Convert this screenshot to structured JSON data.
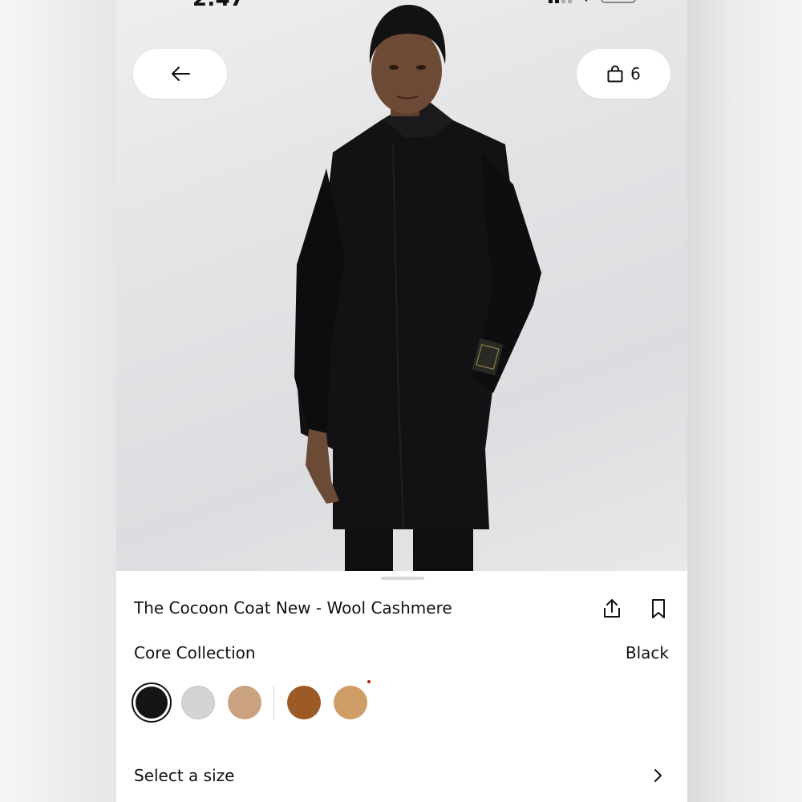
{
  "status_bar": {
    "time": "2:47"
  },
  "header": {
    "back_icon": "arrow-left-icon",
    "bag_icon": "shopping-bag-icon",
    "bag_count": "6"
  },
  "product": {
    "title": "The Cocoon Coat New - Wool Cashmere",
    "collection": "Core Collection",
    "selected_color": "Black",
    "actions": {
      "share_icon": "share-icon",
      "bookmark_icon": "bookmark-icon"
    },
    "swatches": [
      {
        "color": "#151515",
        "selected": true
      },
      {
        "color": "#d4d4d4",
        "selected": false
      },
      {
        "color": "#caa27f",
        "selected": false
      },
      {
        "color": "#9c5a27",
        "selected": false
      },
      {
        "color": "#cf9d66",
        "selected": false,
        "new_indicator": true
      }
    ]
  },
  "size_selector": {
    "label": "Select a size",
    "chevron_icon": "chevron-right-icon"
  }
}
